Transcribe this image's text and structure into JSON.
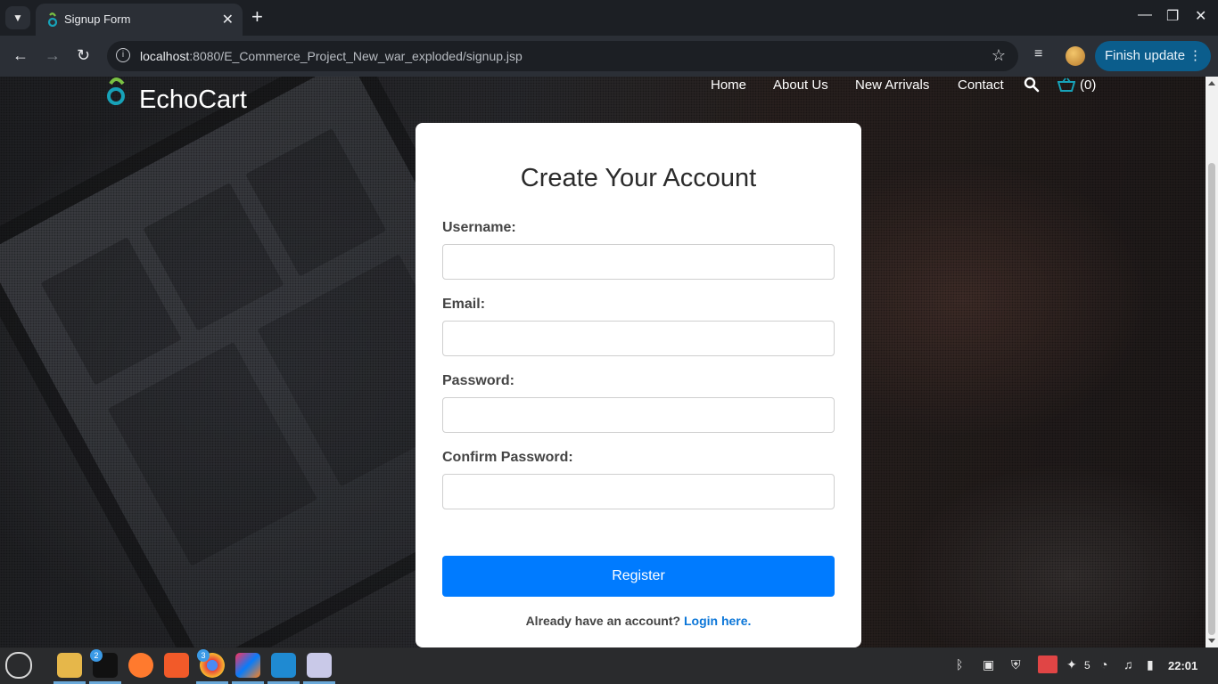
{
  "browser": {
    "tab_title": "Signup Form",
    "url_host": "localhost",
    "url_path": ":8080/E_Commerce_Project_New_war_exploded/signup.jsp",
    "finish_update_label": "Finish update"
  },
  "site": {
    "brand": "EchoCart",
    "nav": [
      "Home",
      "About Us",
      "New Arrivals",
      "Contact"
    ],
    "cart_count": "(0)",
    "accent": "#17a2b8"
  },
  "form": {
    "title": "Create Your Account",
    "username_label": "Username:",
    "email_label": "Email:",
    "password_label": "Password:",
    "confirm_label": "Confirm Password:",
    "username_value": "",
    "email_value": "",
    "password_value": "",
    "confirm_value": "",
    "register_label": "Register",
    "already_text": "Already have an account?",
    "login_link": "Login here.",
    "button_color": "#007bff"
  },
  "taskbar": {
    "terminal_badge": "2",
    "chrome_badge": "3",
    "notifications_count": "5",
    "clock": "22:01"
  }
}
